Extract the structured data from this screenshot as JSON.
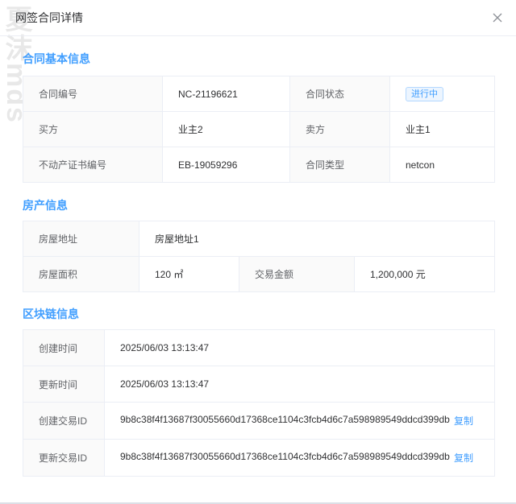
{
  "dialog": {
    "title": "网签合同详情",
    "watermark": "夏沫mds"
  },
  "basic": {
    "section_title": "合同基本信息",
    "contract_no_label": "合同编号",
    "contract_no": "NC-21196621",
    "status_label": "合同状态",
    "status": "进行中",
    "buyer_label": "买方",
    "buyer": "业主2",
    "seller_label": "卖方",
    "seller": "业主1",
    "cert_label": "不动产证书编号",
    "cert": "EB-19059296",
    "type_label": "合同类型",
    "type": "netcon"
  },
  "property": {
    "section_title": "房产信息",
    "address_label": "房屋地址",
    "address": "房屋地址1",
    "area_label": "房屋面积",
    "area": "120 ㎡",
    "amount_label": "交易金额",
    "amount": "1,200,000 元"
  },
  "chain": {
    "section_title": "区块链信息",
    "created_label": "创建时间",
    "created": "2025/06/03 13:13:47",
    "updated_label": "更新时间",
    "updated": "2025/06/03 13:13:47",
    "create_tx_label": "创建交易ID",
    "create_tx": "9b8c38f4f13687f30055660d17368ce1104c3fcb4d6c7a598989549ddcd399db",
    "update_tx_label": "更新交易ID",
    "update_tx": "9b8c38f4f13687f30055660d17368ce1104c3fcb4d6c7a598989549ddcd399db",
    "copy_label": "复制"
  },
  "colors": {
    "accent": "#409eff",
    "border": "#ebeef5",
    "label_bg": "#fafafa"
  },
  "icons": {
    "close": "close-icon"
  }
}
